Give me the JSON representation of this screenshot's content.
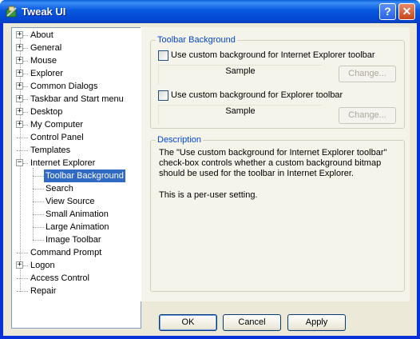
{
  "window": {
    "title": "Tweak UI",
    "help_glyph": "?",
    "close_glyph": "✕"
  },
  "tree": {
    "items": [
      {
        "label": "About",
        "expander": "+"
      },
      {
        "label": "General",
        "expander": "+"
      },
      {
        "label": "Mouse",
        "expander": "+"
      },
      {
        "label": "Explorer",
        "expander": "+"
      },
      {
        "label": "Common Dialogs",
        "expander": "+"
      },
      {
        "label": "Taskbar and Start menu",
        "expander": "+"
      },
      {
        "label": "Desktop",
        "expander": "+"
      },
      {
        "label": "My Computer",
        "expander": "+"
      },
      {
        "label": "Control Panel",
        "expander": ""
      },
      {
        "label": "Templates",
        "expander": ""
      },
      {
        "label": "Internet Explorer",
        "expander": "−"
      },
      {
        "label": "Toolbar Background",
        "expander": ""
      },
      {
        "label": "Search",
        "expander": ""
      },
      {
        "label": "View Source",
        "expander": ""
      },
      {
        "label": "Small Animation",
        "expander": ""
      },
      {
        "label": "Large Animation",
        "expander": ""
      },
      {
        "label": "Image Toolbar",
        "expander": ""
      },
      {
        "label": "Command Prompt",
        "expander": ""
      },
      {
        "label": "Logon",
        "expander": "+"
      },
      {
        "label": "Access Control",
        "expander": ""
      },
      {
        "label": "Repair",
        "expander": ""
      }
    ],
    "selected": "Toolbar Background"
  },
  "toolbar_background": {
    "group_title": "Toolbar Background",
    "ie_checkbox_label": "Use custom background for Internet Explorer toolbar",
    "ie_checked": false,
    "ie_sample": "Sample",
    "ie_change": "Change...",
    "explorer_checkbox_label": "Use custom background for Explorer toolbar",
    "explorer_checked": false,
    "explorer_sample": "Sample",
    "explorer_change": "Change..."
  },
  "description": {
    "title": "Description",
    "paragraph1": "The \"Use custom background for Internet Explorer toolbar\" check-box controls whether a custom background bitmap should be used for the toolbar in Internet Explorer.",
    "paragraph2": "This is a per-user setting."
  },
  "buttons": {
    "ok": "OK",
    "cancel": "Cancel",
    "apply": "Apply"
  }
}
